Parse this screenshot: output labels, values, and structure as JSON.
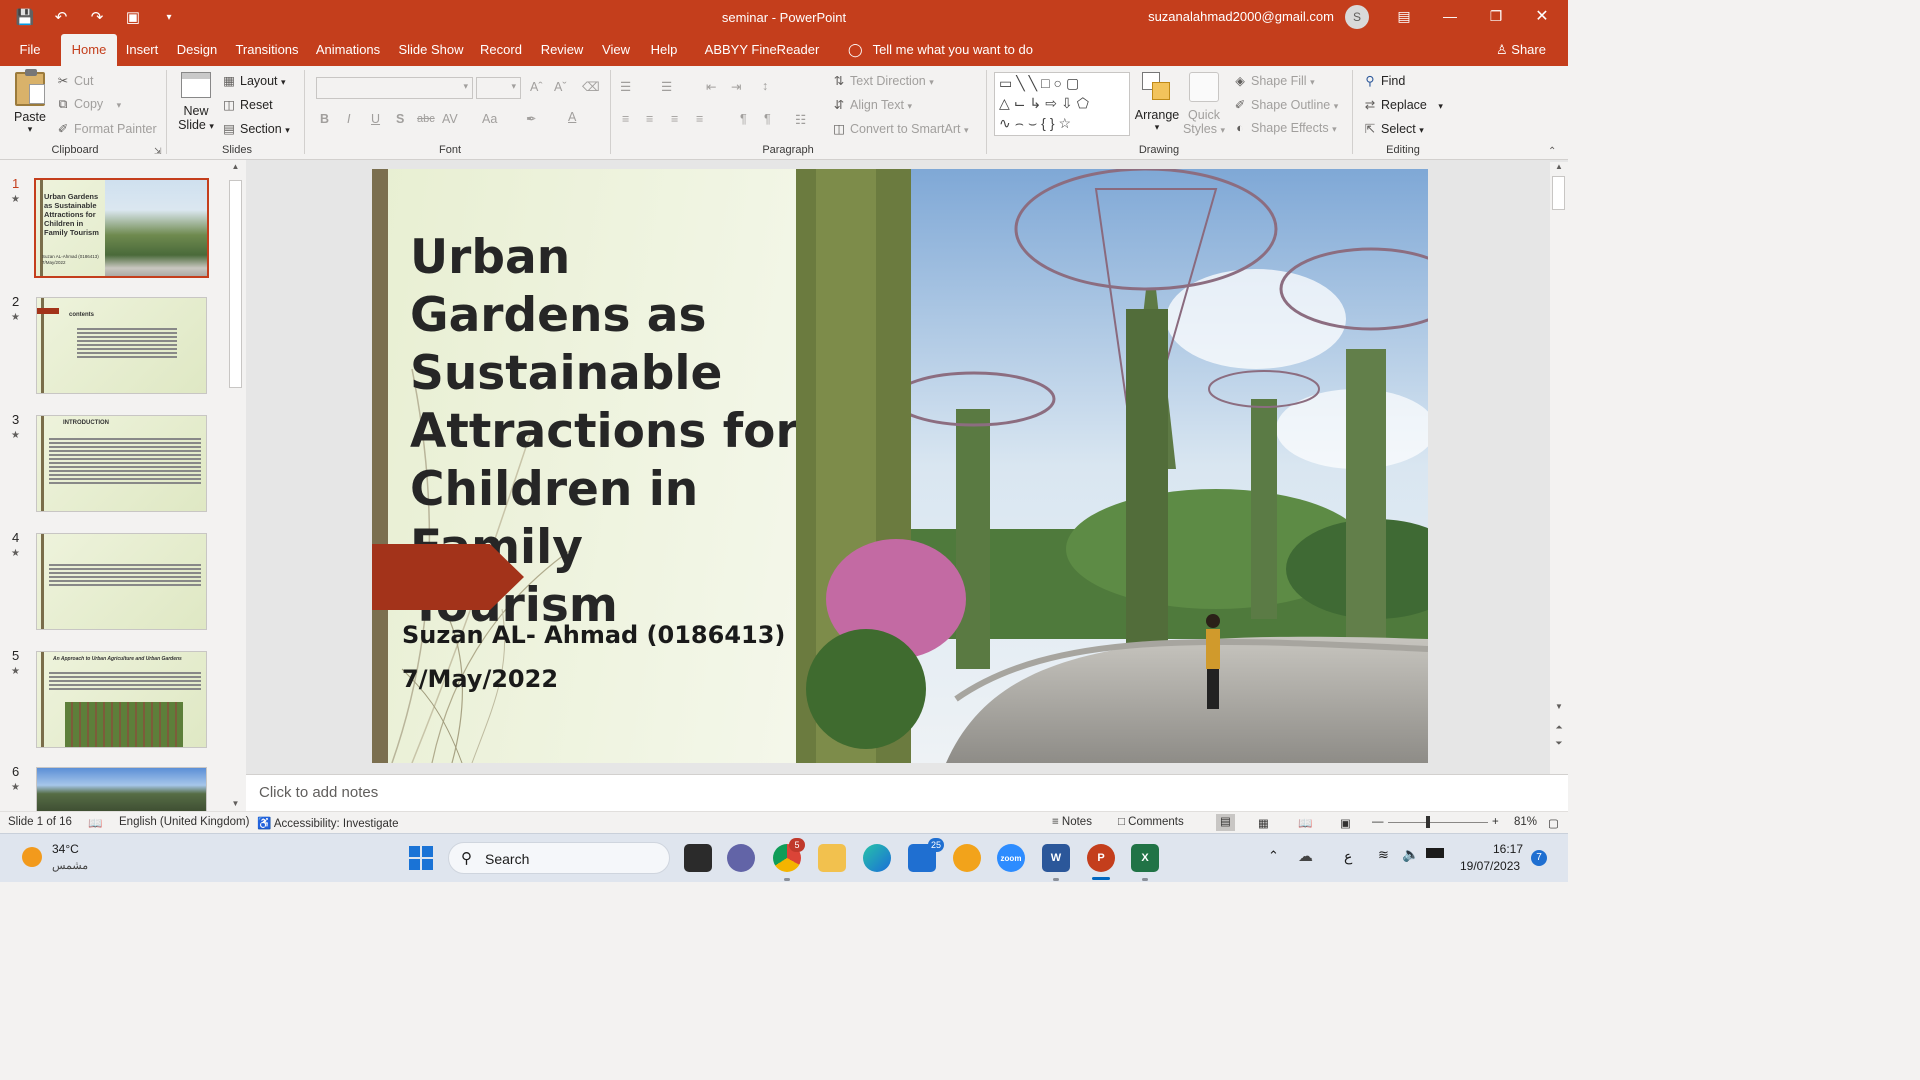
{
  "window": {
    "title": "seminar  -  PowerPoint",
    "user_email": "suzanalahmad2000@gmail.com",
    "avatar_initial": "S",
    "accent": "#c43e1c"
  },
  "tabs": [
    "File",
    "Home",
    "Insert",
    "Design",
    "Transitions",
    "Animations",
    "Slide Show",
    "Record",
    "Review",
    "View",
    "Help",
    "ABBYY FineReader PDF"
  ],
  "active_tab": "Home",
  "tell_me": "Tell me what you want to do",
  "share": "Share",
  "ribbon": {
    "clipboard": {
      "paste": "Paste",
      "cut": "Cut",
      "copy": "Copy",
      "format_painter": "Format Painter",
      "label": "Clipboard"
    },
    "slides": {
      "new_slide": "New",
      "new_slide2": "Slide",
      "layout": "Layout",
      "reset": "Reset",
      "section": "Section",
      "label": "Slides"
    },
    "font": {
      "label": "Font",
      "bold": "B",
      "italic": "I",
      "underline": "U",
      "shadow": "S",
      "strike": "abc",
      "spacing": "AV",
      "case": "Aa"
    },
    "paragraph": {
      "label": "Paragraph",
      "text_direction": "Text Direction",
      "align_text": "Align Text",
      "convert_smartart": "Convert to SmartArt"
    },
    "drawing": {
      "label": "Drawing",
      "arrange": "Arrange",
      "quick_styles": "Quick",
      "quick_styles2": "Styles",
      "shape_fill": "Shape Fill",
      "shape_outline": "Shape Outline",
      "shape_effects": "Shape Effects"
    },
    "editing": {
      "label": "Editing",
      "find": "Find",
      "replace": "Replace",
      "select": "Select"
    }
  },
  "thumbnails": [
    {
      "num": "1",
      "title": "Urban Gardens as Sustainable Attractions for Children in Family Tourism",
      "author": "Suzan AL-Ahmad (0186413)",
      "date": "7/May/2022"
    },
    {
      "num": "2",
      "title": "contents"
    },
    {
      "num": "3",
      "title": "INTRODUCTION"
    },
    {
      "num": "4",
      "title": ""
    },
    {
      "num": "5",
      "title": "An Approach to Urban Agriculture and Urban Gardens"
    },
    {
      "num": "6",
      "title": ""
    }
  ],
  "slide": {
    "title": "Urban Gardens as Sustainable Attractions for Children in Family Tourism",
    "author": "Suzan AL- Ahmad (0186413)",
    "date": "7/May/2022"
  },
  "notes_placeholder": "Click to add notes",
  "status": {
    "slide_count": "Slide 1 of 16",
    "language": "English (United Kingdom)",
    "accessibility": "Accessibility: Investigate",
    "notes": "Notes",
    "comments": "Comments",
    "zoom": "81%"
  },
  "taskbar": {
    "weather_temp": "34°C",
    "weather_desc": "مشمس",
    "search": "Search",
    "time": "16:17",
    "date": "19/07/2023",
    "mail_badge": "25",
    "chrome_badge": "5",
    "notif_count": "7",
    "lang": "ع"
  }
}
